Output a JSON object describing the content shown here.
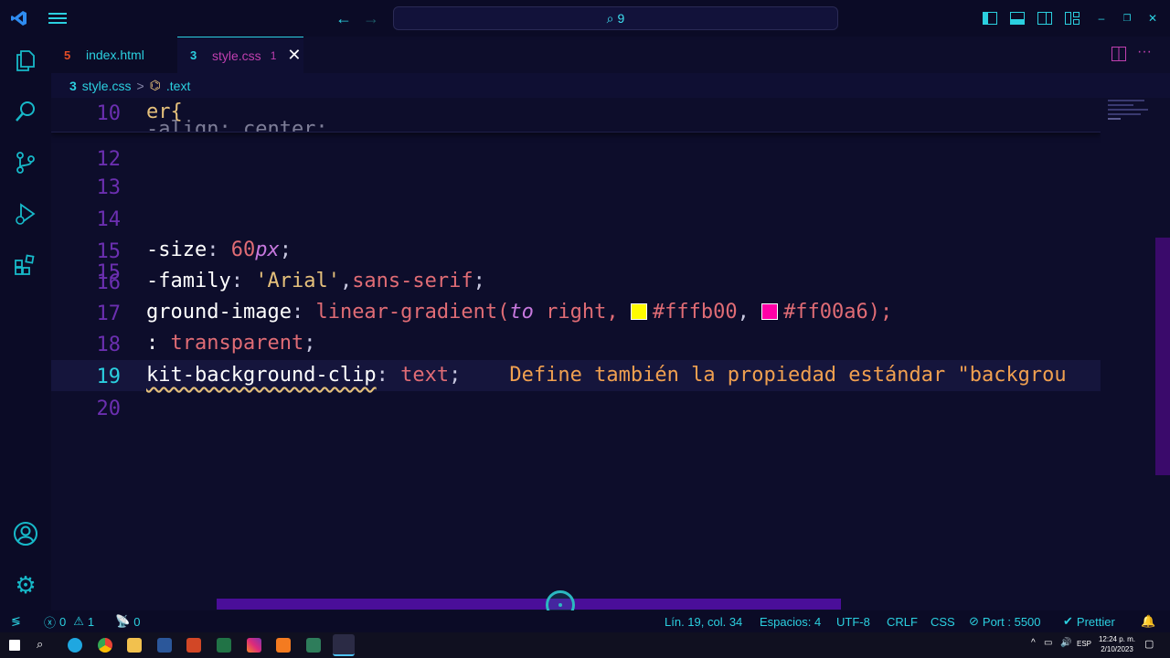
{
  "titlebar": {
    "search_text": "9"
  },
  "tabs": [
    {
      "label": "index.html",
      "icon": "html5-icon"
    },
    {
      "label": "style.css",
      "icon": "css3-icon",
      "count": "1"
    }
  ],
  "breadcrumb": {
    "file": "style.css",
    "separator": ">",
    "symbol": ".text"
  },
  "editor": {
    "sticky_line": {
      "number": "10",
      "code": "er{",
      "sub": "-align: center;"
    },
    "lines": [
      {
        "number": "12"
      },
      {
        "number": "13"
      },
      {
        "number": "14"
      },
      {
        "number": "15",
        "prop": "-size",
        "value_num": "60",
        "value_unit": "px"
      },
      {
        "number": "16",
        "prop": "-family",
        "value_str": "'Arial'",
        "value_rest": "sans-serif"
      },
      {
        "number": "17",
        "prop": "ground-image",
        "fn": "linear-gradient(",
        "kw": "to",
        "dir": " right,",
        "color1": "#fffb00",
        "color2": "#ff00a6",
        "end": ");"
      },
      {
        "number": "18",
        "prop": ":",
        "value": "transparent"
      },
      {
        "number": "19",
        "prop": "kit-background-clip",
        "value": "text",
        "hint": "Define también la propiedad estándar \"backgrou"
      },
      {
        "number": "20"
      }
    ]
  },
  "statusbar": {
    "errors": "0",
    "warnings": "1",
    "ports": "0",
    "position": "Lín. 19, col. 34",
    "spaces": "Espacios: 4",
    "encoding": "UTF-8",
    "eol": "CRLF",
    "language": "CSS",
    "port": "Port : 5500",
    "formatter": "Prettier"
  },
  "taskbar": {
    "lang": "ESP",
    "time": "12:24 p. m.",
    "date": "2/10/2023"
  },
  "colors": {
    "accent": "#2bd0e0",
    "line_number": "#6b2fb0",
    "scrollbar": "#4a0e99"
  }
}
